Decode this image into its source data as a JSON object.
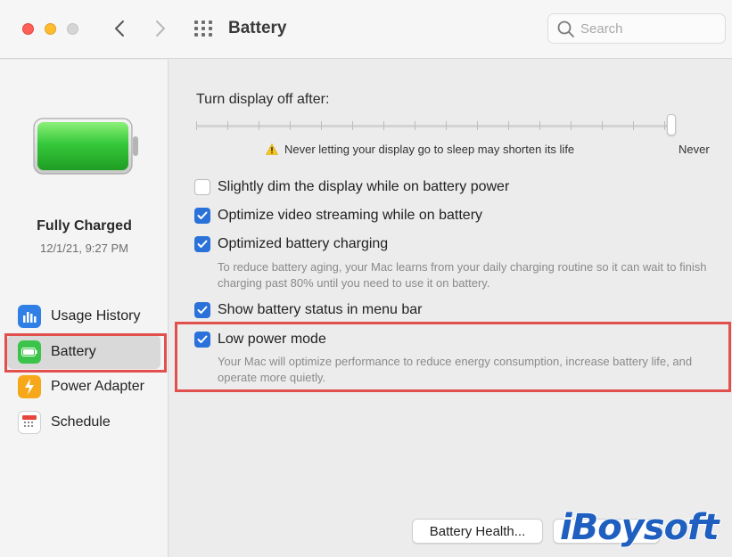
{
  "window": {
    "title": "Battery",
    "search_placeholder": "Search"
  },
  "sidebar": {
    "status": "Fully Charged",
    "date": "12/1/21, 9:27 PM",
    "items": [
      {
        "label": "Usage History",
        "icon": "usage-history-icon"
      },
      {
        "label": "Battery",
        "icon": "battery-icon",
        "selected": true
      },
      {
        "label": "Power Adapter",
        "icon": "power-adapter-icon"
      },
      {
        "label": "Schedule",
        "icon": "schedule-icon"
      }
    ]
  },
  "main": {
    "turn_display_off_label": "Turn display off after:",
    "slider_value": "Never",
    "slider_warning": "Never letting your display go to sleep may shorten its life",
    "options": [
      {
        "label": "Slightly dim the display while on battery power",
        "checked": false
      },
      {
        "label": "Optimize video streaming while on battery",
        "checked": true
      },
      {
        "label": "Optimized battery charging",
        "checked": true,
        "description": "To reduce battery aging, your Mac learns from your daily charging routine so it can wait to finish charging past 80% until you need to use it on battery."
      },
      {
        "label": "Show battery status in menu bar",
        "checked": true
      },
      {
        "label": "Low power mode",
        "checked": true,
        "description": "Your Mac will optimize performance to reduce energy consumption, increase battery life, and operate more quietly."
      }
    ],
    "buttons": {
      "battery_health": "Battery Health..."
    }
  },
  "watermark": "iBoysoft",
  "colors": {
    "accent": "#2a72d9",
    "highlight": "#e2504e",
    "battery_green": "#36c93a"
  }
}
